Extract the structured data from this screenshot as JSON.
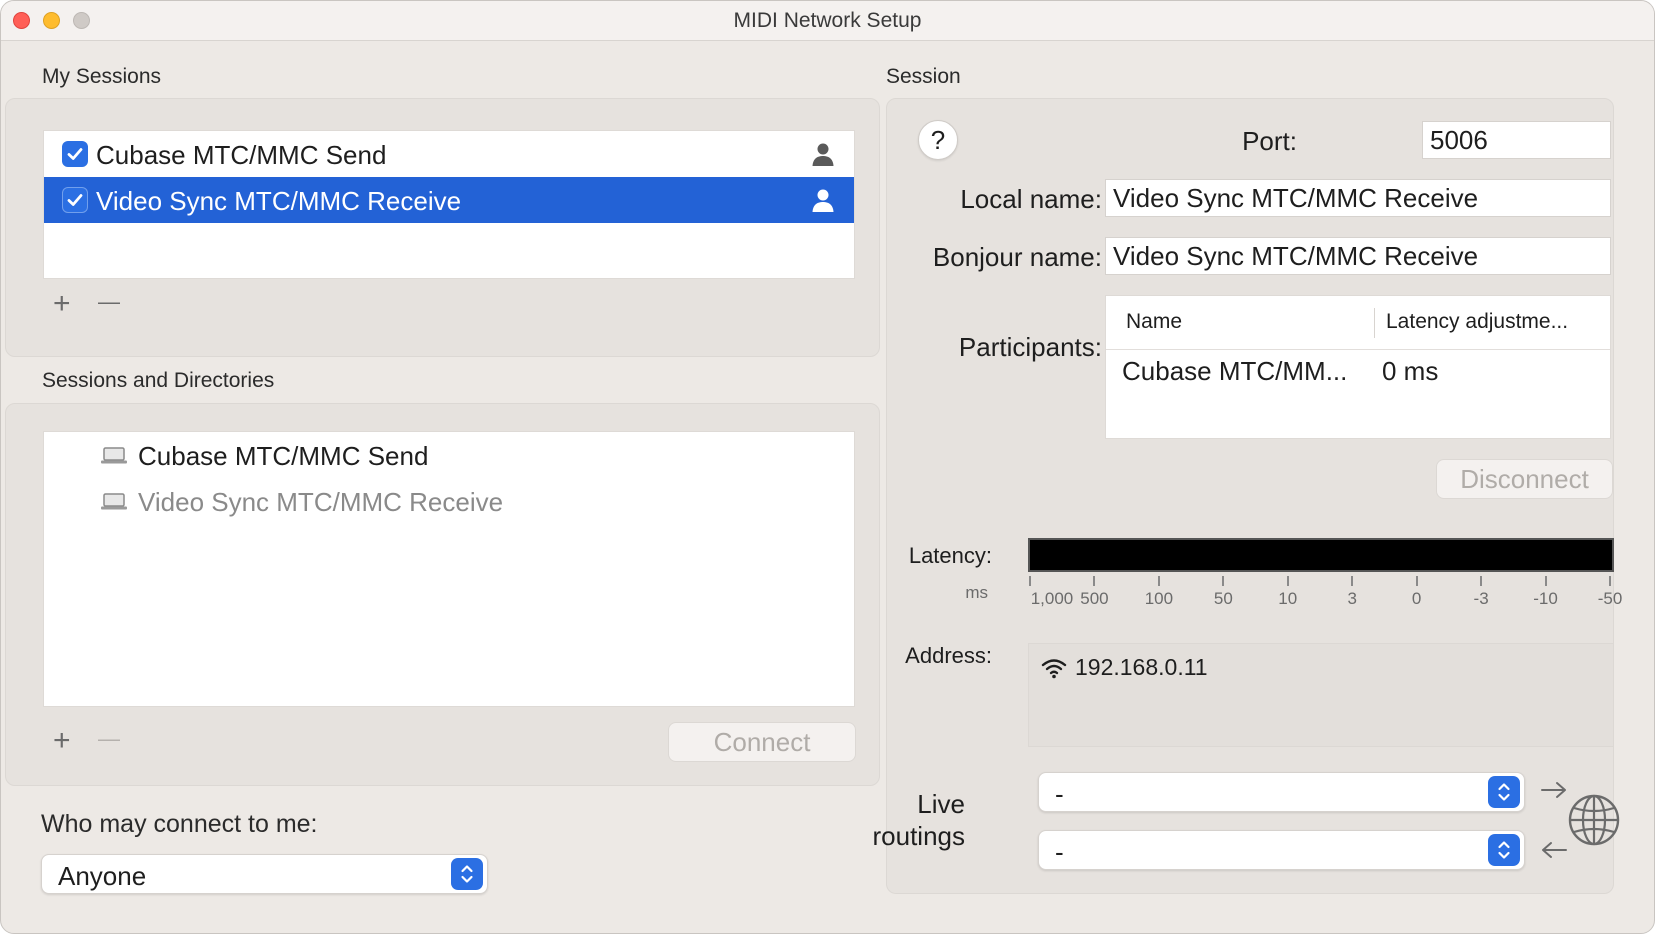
{
  "window": {
    "title": "MIDI Network Setup"
  },
  "my_sessions": {
    "heading": "My Sessions",
    "items": [
      {
        "label": "Cubase MTC/MMC Send",
        "checked": true,
        "selected": false
      },
      {
        "label": "Video Sync MTC/MMC Receive",
        "checked": true,
        "selected": true
      }
    ],
    "add_symbol": "+",
    "remove_symbol": "—"
  },
  "directories": {
    "heading": "Sessions and Directories",
    "items": [
      {
        "label": "Cubase MTC/MMC Send",
        "dimmed": false
      },
      {
        "label": "Video Sync MTC/MMC Receive",
        "dimmed": true
      }
    ],
    "add_symbol": "+",
    "remove_symbol": "—",
    "connect_label": "Connect"
  },
  "who_may_connect": {
    "label": "Who may connect to me:",
    "value": "Anyone"
  },
  "session": {
    "heading": "Session",
    "help_symbol": "?",
    "port_label": "Port:",
    "port_value": "5006",
    "local_name_label": "Local name:",
    "local_name_value": "Video Sync MTC/MMC Receive",
    "bonjour_name_label": "Bonjour name:",
    "bonjour_name_value": "Video Sync MTC/MMC Receive",
    "participants_label": "Participants:",
    "participants_columns": [
      "Name",
      "Latency adjustme..."
    ],
    "participants_rows": [
      {
        "name": "Cubase MTC/MM...",
        "latency": "0 ms"
      }
    ],
    "disconnect_label": "Disconnect",
    "latency_label": "Latency:",
    "latency_unit": "ms",
    "latency_ticks": [
      "1,000",
      "500",
      "100",
      "50",
      "10",
      "3",
      "0",
      "-3",
      "-10",
      "-50"
    ],
    "address_label": "Address:",
    "address_value": "192.168.0.11",
    "live_routings_label_1": "Live",
    "live_routings_label_2": "routings",
    "routing_out_value": "-",
    "routing_in_value": "-"
  },
  "colors": {
    "selection": "#2362d6",
    "accent": "#2b6fe3",
    "window_bg": "#ede9e5"
  },
  "icons": [
    "person-icon",
    "laptop-icon",
    "wifi-icon",
    "arrow-right-icon",
    "arrow-left-icon",
    "globe-icon",
    "checkmark-icon",
    "chevron-updown-icon"
  ]
}
